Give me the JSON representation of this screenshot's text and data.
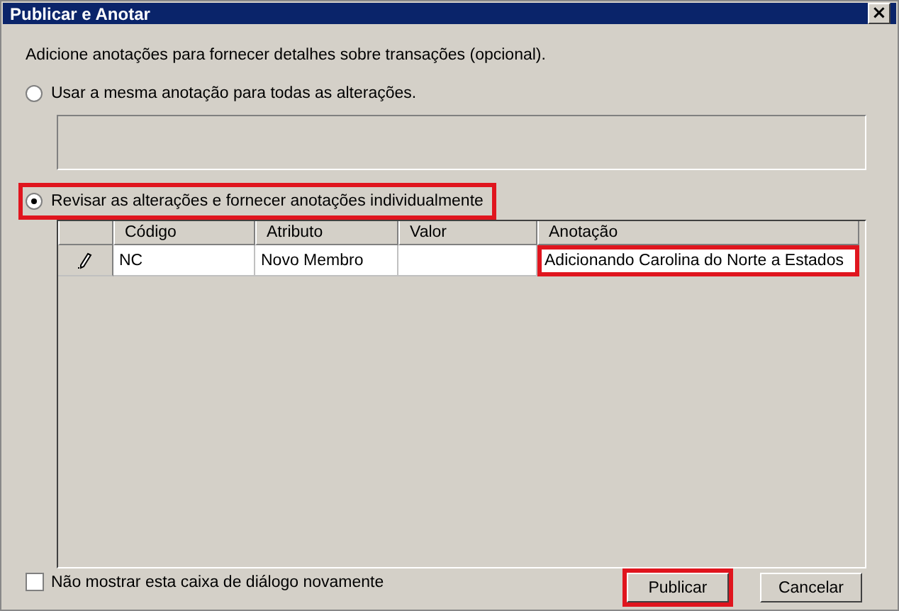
{
  "window": {
    "title": "Publicar e Anotar",
    "close": "×"
  },
  "intro": "Adicione anotações para fornecer detalhes sobre transações (opcional).",
  "options": [
    {
      "label": "Usar a mesma anotação para todas as alterações.",
      "selected": false,
      "highlighted": false
    },
    {
      "label": "Revisar as alterações e fornecer anotações individualmente",
      "selected": true,
      "highlighted": true
    }
  ],
  "shared_annotation": {
    "disabled": true
  },
  "table": {
    "columns": [
      "Código",
      "Atributo",
      "Valor",
      "Anotação"
    ],
    "rows": [
      {
        "cells": [
          "NC",
          "Novo Membro",
          "",
          "Adicionando Carolina do Norte a Estados"
        ],
        "editing": true,
        "highlighted_cells": [
          false,
          false,
          false,
          true
        ]
      }
    ]
  },
  "dont_show_again": {
    "label": "Não mostrar esta caixa de diálogo novamente",
    "checked": false
  },
  "buttons": [
    {
      "label": "Publicar",
      "highlighted": true
    },
    {
      "label": "Cancelar",
      "highlighted": false
    }
  ]
}
